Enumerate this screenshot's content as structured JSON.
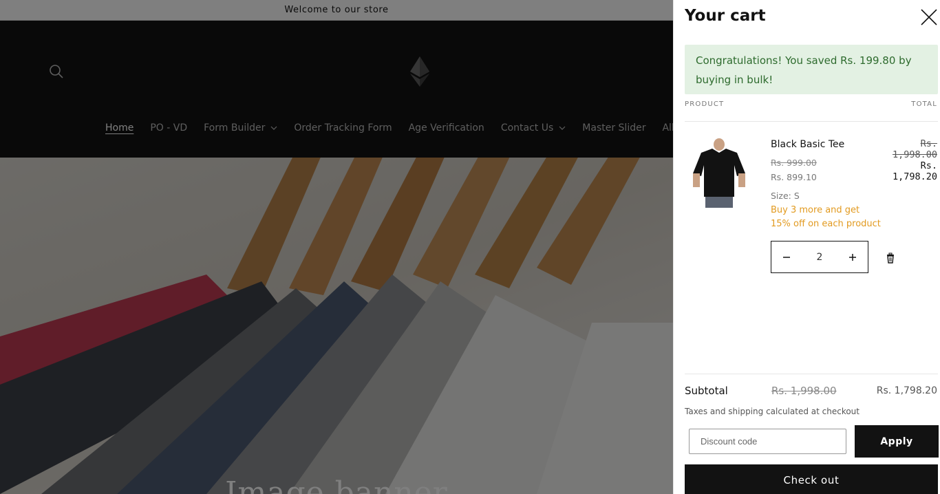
{
  "store": {
    "announcement": "Welcome to our store",
    "nav": [
      {
        "label": "Home",
        "active": true,
        "dropdown": false
      },
      {
        "label": "PO - VD",
        "active": false,
        "dropdown": false
      },
      {
        "label": "Form Builder",
        "active": false,
        "dropdown": true
      },
      {
        "label": "Order Tracking Form",
        "active": false,
        "dropdown": false
      },
      {
        "label": "Age Verification",
        "active": false,
        "dropdown": false
      },
      {
        "label": "Contact Us",
        "active": false,
        "dropdown": true
      },
      {
        "label": "Master Slider",
        "active": false,
        "dropdown": false
      },
      {
        "label": "All Reviews",
        "active": false,
        "dropdown": false
      }
    ],
    "banner_title": "Image banner"
  },
  "cart": {
    "title": "Your cart",
    "bulk_message": "Congratulations! You saved Rs. 199.80 by buying in bulk!",
    "col_product": "PRODUCT",
    "col_total": "TOTAL",
    "item": {
      "name": "Black Basic Tee",
      "compare_price": "Rs. 999.00",
      "price": "Rs. 899.10",
      "size": "Size: S",
      "offer": "Buy 3 more and get 15% off on each product",
      "quantity": "2",
      "line_total_compare": "Rs. 1,998.00",
      "line_total": "Rs. 1,798.20"
    },
    "subtotal_label": "Subtotal",
    "subtotal_compare": "Rs. 1,998.00",
    "subtotal": "Rs. 1,798.20",
    "tax_note": "Taxes and shipping calculated at checkout",
    "discount_placeholder": "Discount code",
    "apply_label": "Apply",
    "checkout_label": "Check out"
  },
  "icons": {
    "search": "search-icon",
    "close": "close-icon",
    "minus": "minus-icon",
    "plus": "plus-icon",
    "remove": "trash-icon",
    "chevron": "chevron-down-icon"
  },
  "colors": {
    "dark": "#121212",
    "success_bg": "#e3f1e3",
    "success_text": "#2e6b2e",
    "offer": "#e29a1f"
  }
}
